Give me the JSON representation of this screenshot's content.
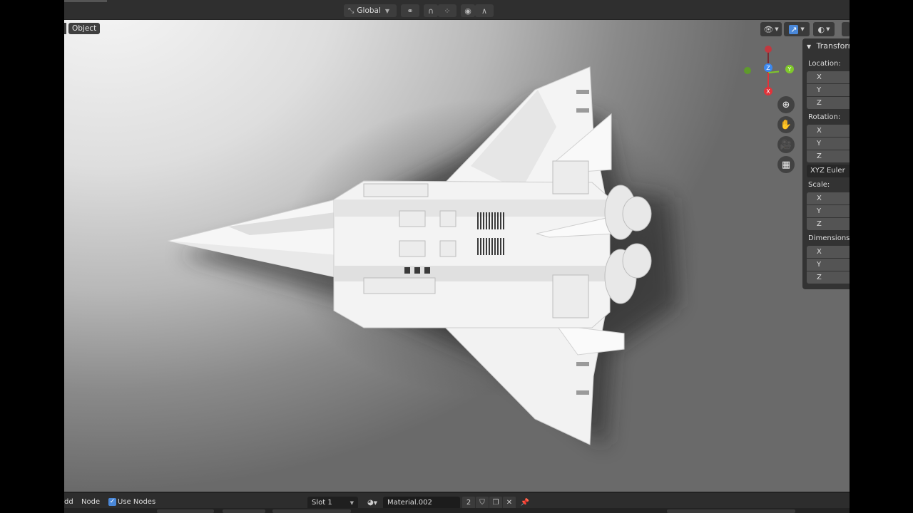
{
  "header": {
    "transform_orientation": "Global",
    "icons": [
      "orientation-icon",
      "link-icon",
      "snap-magnet-icon",
      "snap-grid-icon",
      "proportional-edit-icon",
      "falloff-curve-icon"
    ]
  },
  "viewport": {
    "mode_badge": "Object",
    "gizmo_axes": [
      "X",
      "Y",
      "Z"
    ],
    "nav_icons": [
      "zoom-icon",
      "pan-hand-icon",
      "camera-icon",
      "grid-ortho-icon"
    ]
  },
  "npanel": {
    "title": "Transform",
    "location_label": "Location:",
    "rotation_label": "Rotation:",
    "rotation_mode": "XYZ Euler",
    "scale_label": "Scale:",
    "dimensions_label": "Dimensions:",
    "axes": [
      "X",
      "Y",
      "Z"
    ]
  },
  "bottom_bar": {
    "add_label": "dd",
    "node_label": "Node",
    "use_nodes_label": "Use Nodes",
    "use_nodes_checked": true,
    "slot": "Slot 1",
    "material_name": "Material.002",
    "material_users": "2"
  },
  "colors": {
    "axis_x": "#e0333a",
    "axis_y": "#7fc92a",
    "axis_z": "#3b88f0",
    "accent": "#4a88d9"
  }
}
